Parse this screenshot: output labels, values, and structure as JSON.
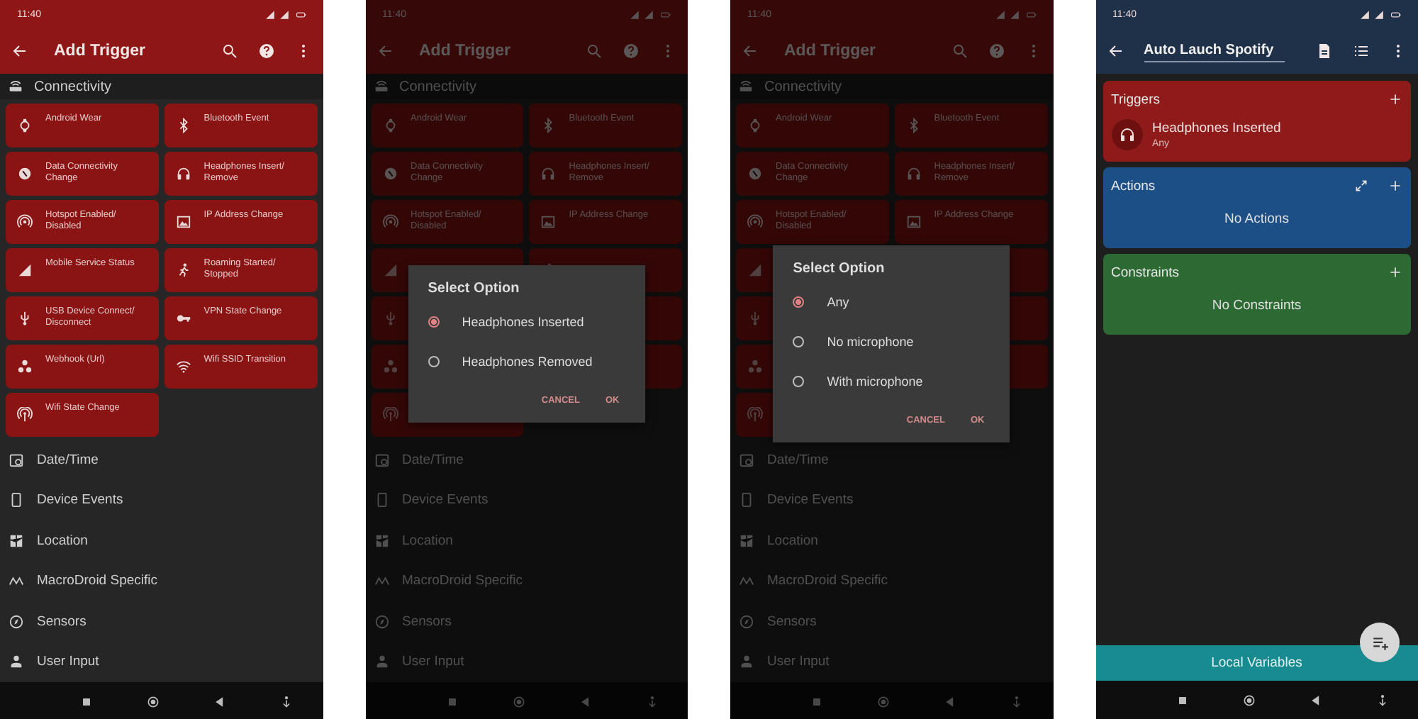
{
  "screens": [
    {
      "kind": "trigger_list",
      "dimmed": false,
      "status_bar": {
        "time": "11:40"
      },
      "app_bar": {
        "title": "Add Trigger"
      },
      "section": {
        "title": "Connectivity"
      },
      "triggers": [
        {
          "label": "Android Wear"
        },
        {
          "label": "Bluetooth Event"
        },
        {
          "label": "Data Connectivity Change"
        },
        {
          "label": "Headphones Insert/ Remove"
        },
        {
          "label": "Hotspot Enabled/ Disabled"
        },
        {
          "label": "IP Address Change"
        },
        {
          "label": "Mobile Service Status"
        },
        {
          "label": "Roaming Started/ Stopped"
        },
        {
          "label": "USB Device Connect/ Disconnect"
        },
        {
          "label": "VPN State Change"
        },
        {
          "label": "Webhook (Url)"
        },
        {
          "label": "Wifi SSID Transition"
        },
        {
          "label": "Wifi State Change"
        }
      ],
      "categories": [
        {
          "label": "Date/Time"
        },
        {
          "label": "Device Events"
        },
        {
          "label": "Location"
        },
        {
          "label": "MacroDroid Specific"
        },
        {
          "label": "Sensors"
        },
        {
          "label": "User Input"
        }
      ]
    },
    {
      "kind": "trigger_list",
      "dimmed": true,
      "status_bar": {
        "time": "11:40"
      },
      "app_bar": {
        "title": "Add Trigger"
      },
      "section": {
        "title": "Connectivity"
      },
      "triggers": [
        {
          "label": "Android Wear"
        },
        {
          "label": "Bluetooth Event"
        },
        {
          "label": "Data Connectivity Change"
        },
        {
          "label": "Headphones Insert/ Remove"
        },
        {
          "label": "Hotspot Enabled/ Disabled"
        },
        {
          "label": "IP Address Change"
        },
        {
          "kind": "icon_only"
        },
        {
          "kind": "icon_only"
        },
        {
          "kind": "icon_only"
        },
        {
          "kind": "card_only"
        },
        {
          "kind": "icon_only"
        },
        {
          "kind": "card_only"
        },
        {
          "kind": "icon_only"
        }
      ],
      "categories": [
        {
          "label": "Date/Time"
        },
        {
          "label": "Device Events"
        },
        {
          "label": "Location"
        },
        {
          "label": "MacroDroid Specific"
        },
        {
          "label": "Sensors"
        },
        {
          "label": "User Input"
        }
      ],
      "dialog": {
        "title": "Select Option",
        "options": [
          {
            "label": "Headphones Inserted",
            "selected": true
          },
          {
            "label": "Headphones Removed",
            "selected": false
          }
        ],
        "buttons": [
          "CANCEL",
          "OK"
        ]
      }
    },
    {
      "kind": "trigger_list",
      "dimmed": true,
      "status_bar": {
        "time": "11:40"
      },
      "app_bar": {
        "title": "Add Trigger"
      },
      "section": {
        "title": "Connectivity"
      },
      "triggers": [
        {
          "label": "Android Wear"
        },
        {
          "label": "Bluetooth Event"
        },
        {
          "label": "Data Connectivity Change"
        },
        {
          "label": "Headphones Insert/ Remove"
        },
        {
          "label": "Hotspot Enabled/ Disabled"
        },
        {
          "label": "IP Address Change"
        },
        {
          "kind": "icon_only"
        },
        {
          "kind": "card_only"
        },
        {
          "kind": "icon_only"
        },
        {
          "kind": "card_only"
        },
        {
          "kind": "icon_only"
        },
        {
          "kind": "card_only"
        },
        {
          "kind": "icon_only"
        }
      ],
      "categories": [
        {
          "label": "Date/Time"
        },
        {
          "label": "Device Events"
        },
        {
          "label": "Location"
        },
        {
          "label": "MacroDroid Specific"
        },
        {
          "label": "Sensors"
        },
        {
          "label": "User Input"
        }
      ],
      "dialog": {
        "title": "Select Option",
        "options": [
          {
            "label": "Any",
            "selected": true
          },
          {
            "label": "No microphone",
            "selected": false
          },
          {
            "label": "With microphone",
            "selected": false
          }
        ],
        "buttons": [
          "CANCEL",
          "OK"
        ]
      }
    },
    {
      "kind": "macro_editor",
      "dimmed": false,
      "status_bar": {
        "time": "11:40"
      },
      "app_bar": {
        "title": "Auto Lauch Spotify"
      },
      "panels": [
        {
          "kind": "triggers",
          "title": "Triggers",
          "items": [
            {
              "title": "Headphones Inserted",
              "subtitle": "Any"
            }
          ]
        },
        {
          "kind": "actions",
          "title": "Actions",
          "empty_text": "No Actions"
        },
        {
          "kind": "constraints",
          "title": "Constraints",
          "empty_text": "No Constraints"
        }
      ],
      "footer": {
        "label": "Local Variables"
      }
    }
  ]
}
